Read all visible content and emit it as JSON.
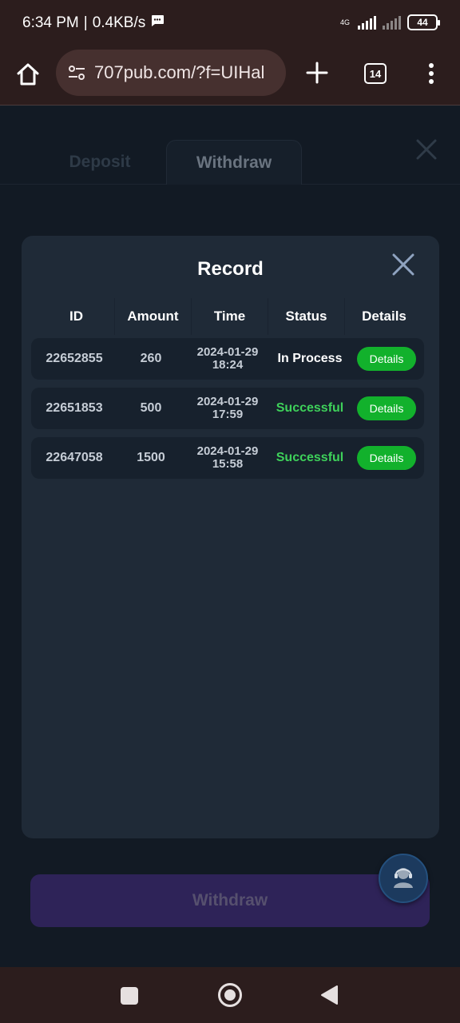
{
  "status_bar": {
    "time": "6:34 PM",
    "speed": "0.4KB/s",
    "network": "4G",
    "battery": "44"
  },
  "browser": {
    "url": "707pub.com/?f=UIHal",
    "tab_count": "14"
  },
  "background_page": {
    "tabs": [
      {
        "label": "Deposit",
        "active": false
      },
      {
        "label": "Withdraw",
        "active": true
      }
    ],
    "withdraw_button": "Withdraw"
  },
  "modal": {
    "title": "Record",
    "columns": [
      "ID",
      "Amount",
      "Time",
      "Status",
      "Details"
    ],
    "rows": [
      {
        "id": "22652855",
        "amount": "260",
        "date": "2024-01-29",
        "time": "18:24",
        "status": "In Process",
        "status_type": "process",
        "details": "Details"
      },
      {
        "id": "22651853",
        "amount": "500",
        "date": "2024-01-29",
        "time": "17:59",
        "status": "Successful",
        "status_type": "success",
        "details": "Details"
      },
      {
        "id": "22647058",
        "amount": "1500",
        "date": "2024-01-29",
        "time": "15:58",
        "status": "Successful",
        "status_type": "success",
        "details": "Details"
      }
    ]
  },
  "colors": {
    "success": "#3ed15a",
    "details_button": "#12b12c",
    "modal_bg": "#1f2a37"
  }
}
